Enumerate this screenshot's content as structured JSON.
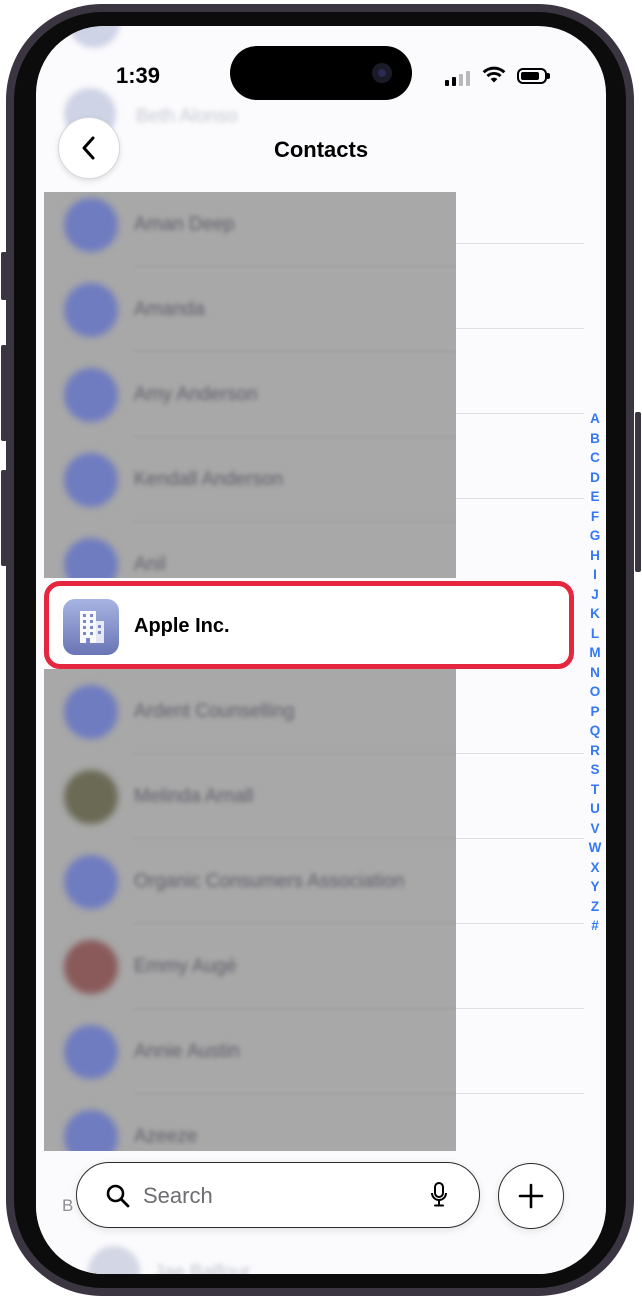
{
  "status_bar": {
    "time": "1:39"
  },
  "header": {
    "title": "Contacts",
    "ghost_above": "Beth Alonso"
  },
  "contacts_blurred_above": [
    {
      "name": "Aman Deep",
      "avatar": "initials"
    },
    {
      "name": "Amanda",
      "avatar": "initials"
    },
    {
      "name": "Amy Anderson",
      "avatar": "initials"
    },
    {
      "name": "Kendall Anderson",
      "avatar": "initials"
    },
    {
      "name": "Anil",
      "avatar": "initials"
    }
  ],
  "highlighted_contact": {
    "name": "Apple Inc.",
    "avatar_icon": "building-icon",
    "highlight_color": "#e5263f"
  },
  "contacts_blurred_below": [
    {
      "name": "Ardent Counselling",
      "avatar": "initials"
    },
    {
      "name": "Melinda Arnall",
      "avatar": "photo"
    },
    {
      "name": "Organic Consumers Association",
      "avatar": "initials"
    },
    {
      "name": "Emmy Augé",
      "avatar": "photo"
    },
    {
      "name": "Annie Austin",
      "avatar": "initials"
    },
    {
      "name": "Azeeze",
      "avatar": "initials"
    }
  ],
  "index_letters": [
    "A",
    "B",
    "C",
    "D",
    "E",
    "F",
    "G",
    "H",
    "I",
    "J",
    "K",
    "L",
    "M",
    "N",
    "O",
    "P",
    "Q",
    "R",
    "S",
    "T",
    "U",
    "V",
    "W",
    "X",
    "Y",
    "Z",
    "#"
  ],
  "section_letter_peek": "B",
  "ghost_below": "Jae Balfour",
  "search": {
    "placeholder": "Search"
  },
  "colors": {
    "accent": "#3478f6",
    "highlight": "#e5263f"
  }
}
